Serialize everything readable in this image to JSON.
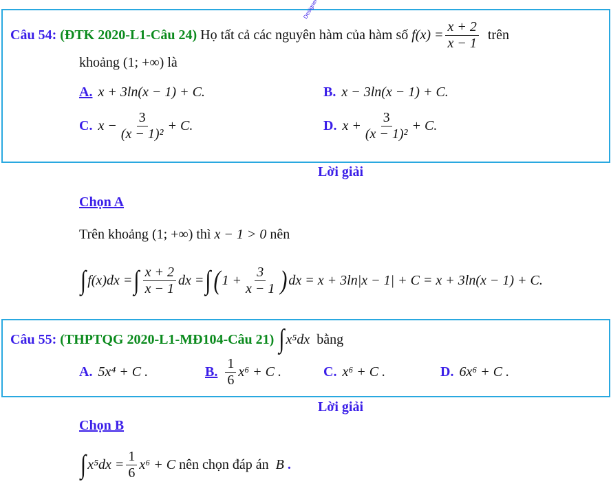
{
  "q54": {
    "label": "Câu 54:",
    "source": "(ĐTK 2020-L1-Câu 24)",
    "stem": "Họ tất cả các nguyên hàm của hàm số",
    "fx": "f(x) =",
    "num": "x + 2",
    "den": "x − 1",
    "tail": "trên",
    "line2a": "khoảng",
    "interval": "(1; +∞)",
    "line2b": "là",
    "options": [
      {
        "key": "A.",
        "pre": "x + 3ln(x − 1) + C."
      },
      {
        "key": "B.",
        "pre": "x − 3ln(x − 1) + C."
      },
      {
        "key": "C.",
        "pre": "x −",
        "num": "3",
        "den": "(x − 1)²",
        "post": "+ C."
      },
      {
        "key": "D.",
        "pre": "x +",
        "num": "3",
        "den": "(x − 1)²",
        "post": "+ C."
      }
    ]
  },
  "sol54": {
    "title": "Lời giải",
    "choice": "Chọn A",
    "l1a": "Trên khoảng",
    "l1b": "(1; +∞)",
    "l1c": "thì",
    "l1d": "x − 1 > 0",
    "l1e": "nên",
    "i1": "∫",
    "i2": "f(x)dx = ",
    "i3": "∫",
    "n1": "x + 2",
    "d1": "x − 1",
    "i4": "dx = ",
    "i5": "∫",
    "p1": "(",
    "i6": "1 +",
    "n2": "3",
    "d2": "x − 1",
    "p2": ")",
    "i7": "dx = x + 3ln|x − 1| + C = x + 3ln(x − 1) + C."
  },
  "q55": {
    "label": "Câu 55:",
    "source": "(THPTQG 2020-L1-MĐ104-Câu 21)",
    "int": "∫",
    "expr": "x⁵dx",
    "tail": "bằng",
    "options": [
      {
        "key": "A.",
        "text": "5x⁴ + C ."
      },
      {
        "key": "B.",
        "num": "1",
        "den": "6",
        "text": "x⁶ + C ."
      },
      {
        "key": "C.",
        "text": "x⁶ + C ."
      },
      {
        "key": "D.",
        "text": "6x⁶ + C ."
      }
    ]
  },
  "sol55": {
    "title": "Lời giải",
    "choice": "Chọn B",
    "int": "∫",
    "a": "x⁵dx =",
    "num": "1",
    "den": "6",
    "b": "x⁶ + C",
    "c": "nên chọn đáp án",
    "d": "B",
    "e": "."
  },
  "watermark": "Designer: Ek"
}
